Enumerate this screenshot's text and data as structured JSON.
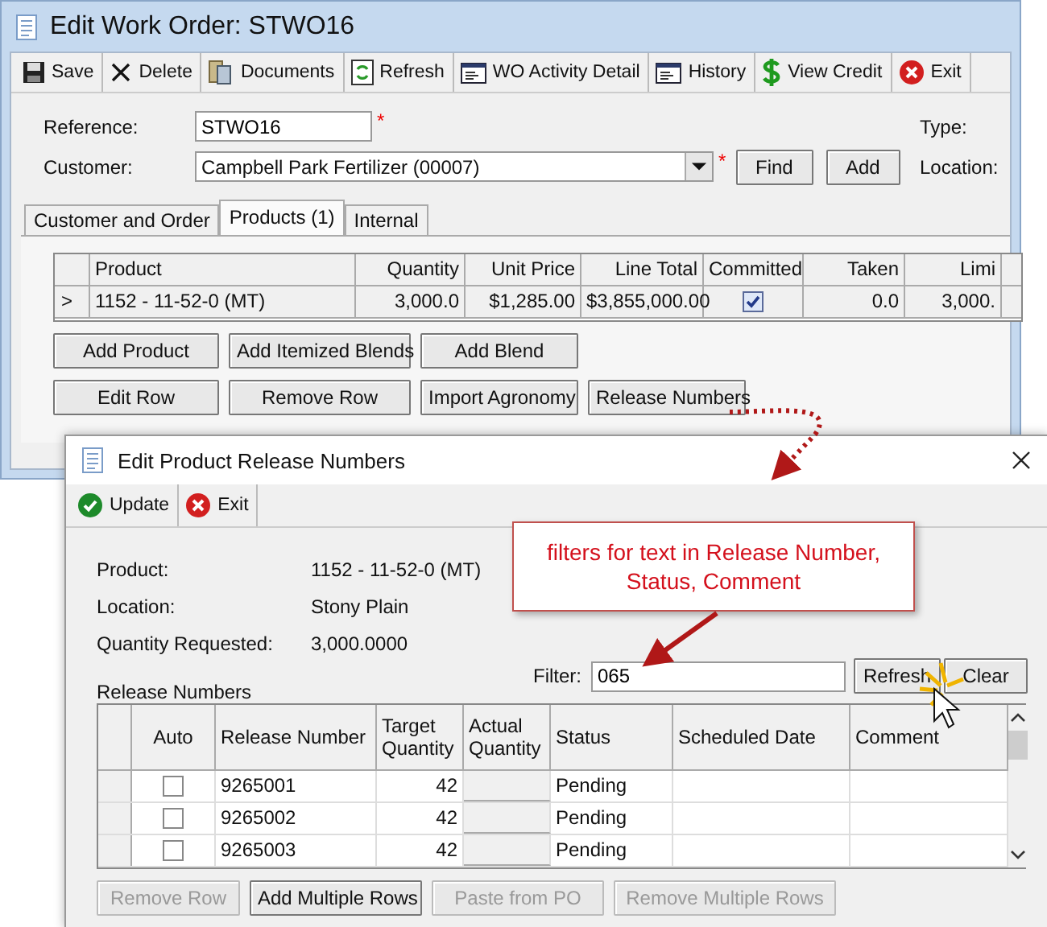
{
  "main_window": {
    "title": "Edit Work Order: STWO16",
    "toolbar": [
      "Save",
      "Delete",
      "Documents",
      "Refresh",
      "WO Activity Detail",
      "History",
      "View Credit",
      "Exit"
    ],
    "form": {
      "reference_label": "Reference:",
      "reference_value": "STWO16",
      "reference_required": "*",
      "customer_label": "Customer:",
      "customer_value": "Campbell Park Fertilizer (00007)",
      "customer_required": "*",
      "find_button": "Find",
      "add_button": "Add",
      "type_label": "Type:",
      "location_label": "Location:"
    },
    "tabs": [
      {
        "label": "Customer and Order",
        "selected": false
      },
      {
        "label": "Products (1)",
        "selected": true
      },
      {
        "label": "Internal",
        "selected": false
      }
    ],
    "products_table": {
      "columns": [
        "Product",
        "Quantity",
        "Unit Price",
        "Line Total",
        "Committed",
        "Taken",
        "Limi"
      ],
      "rows": [
        {
          "indicator": ">",
          "product": "1152 - 11-52-0 (MT)",
          "quantity": "3,000.0",
          "unit_price": "$1,285.00",
          "line_total": "$3,855,000.00",
          "committed": true,
          "taken": "0.0",
          "limit": "3,000."
        }
      ]
    },
    "button_rows": [
      [
        "Add Product",
        "Add Itemized Blends",
        "Add Blend"
      ],
      [
        "Edit Row",
        "Remove Row",
        "Import Agronomy",
        "Release Numbers"
      ]
    ]
  },
  "dialog": {
    "title": "Edit Product Release Numbers",
    "toolbar": [
      "Update",
      "Exit"
    ],
    "info": [
      {
        "label": "Product:",
        "value": "1152 - 11-52-0 (MT)"
      },
      {
        "label": "Location:",
        "value": "Stony Plain"
      },
      {
        "label": "Quantity Requested:",
        "value": "3,000.0000"
      }
    ],
    "section_label": "Release Numbers",
    "filter": {
      "label": "Filter:",
      "value": "065",
      "refresh_button": "Refresh",
      "clear_button": "Clear"
    },
    "table": {
      "columns": [
        "Auto",
        "Release Number",
        "Target Quantity",
        "Actual Quantity",
        "Status",
        "Scheduled Date",
        "Comment"
      ],
      "rows": [
        {
          "auto": false,
          "release_number": "9265001",
          "target_quantity": "42",
          "status": "Pending"
        },
        {
          "auto": false,
          "release_number": "9265002",
          "target_quantity": "42",
          "status": "Pending"
        },
        {
          "auto": false,
          "release_number": "9265003",
          "target_quantity": "42",
          "status": "Pending"
        }
      ]
    },
    "buttons": [
      {
        "label": "Remove Row",
        "disabled": true
      },
      {
        "label": "Add Multiple Rows",
        "disabled": false
      },
      {
        "label": "Paste from PO",
        "disabled": true
      },
      {
        "label": "Remove Multiple Rows",
        "disabled": true
      }
    ]
  },
  "callout": {
    "text": "filters for text in Release Number, Status, Comment"
  }
}
